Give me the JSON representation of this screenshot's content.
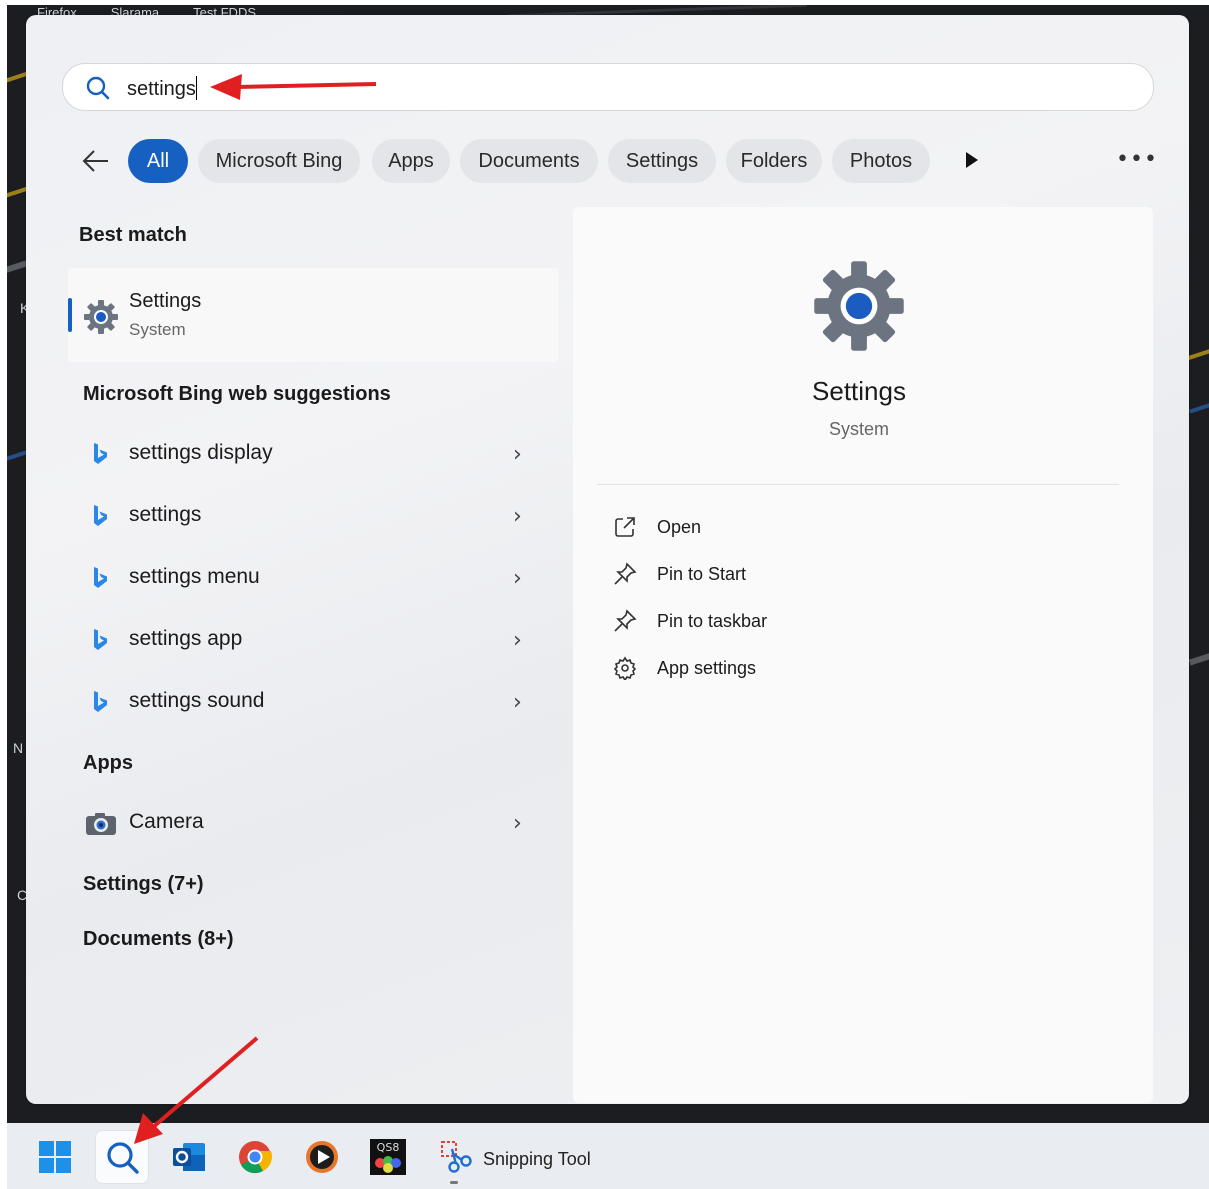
{
  "background": {
    "tabs": [
      "Firefox",
      "Slarama",
      "Test FDDS"
    ],
    "side_letters": [
      "K",
      "N",
      "C"
    ]
  },
  "search": {
    "query": "settings"
  },
  "filters": {
    "chips": [
      "All",
      "Microsoft Bing",
      "Apps",
      "Documents",
      "Settings",
      "Folders",
      "Photos"
    ],
    "active": "All"
  },
  "best_match": {
    "heading": "Best match",
    "title": "Settings",
    "subtitle": "System"
  },
  "bing": {
    "heading": "Microsoft Bing web suggestions",
    "items": [
      "settings display",
      "settings",
      "settings menu",
      "settings app",
      "settings sound"
    ]
  },
  "apps": {
    "heading": "Apps",
    "items": [
      "Camera"
    ]
  },
  "more_sections": [
    "Settings (7+)",
    "Documents (8+)"
  ],
  "preview": {
    "title": "Settings",
    "subtitle": "System",
    "actions": [
      {
        "label": "Open",
        "icon": "open-external-icon"
      },
      {
        "label": "Pin to Start",
        "icon": "pin-icon"
      },
      {
        "label": "Pin to taskbar",
        "icon": "pin-icon"
      },
      {
        "label": "App settings",
        "icon": "gear-icon"
      }
    ]
  },
  "taskbar": {
    "items": [
      "start-icon",
      "search-icon",
      "outlook-icon",
      "chrome-icon",
      "media-player-icon",
      "qs8-icon",
      "snipping-tool-icon"
    ],
    "running_label": "Snipping Tool",
    "qs8_text": "QS8"
  },
  "colors": {
    "accent": "#1560c0",
    "annotation_arrow": "#e02020"
  }
}
